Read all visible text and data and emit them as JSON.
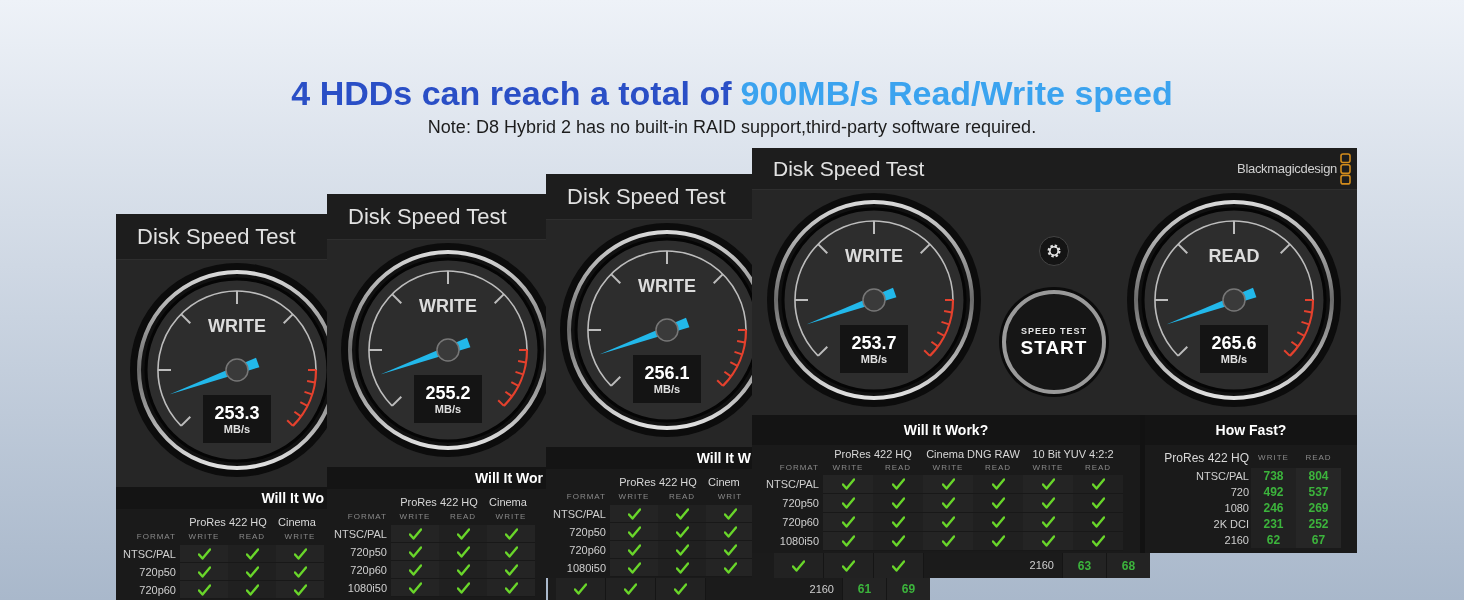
{
  "headline": {
    "lead": "4 HDDs can reach a total of",
    "highlight": "900MB/s Read/Write speed"
  },
  "note": "Note: D8 Hybrid 2 has no built-in RAID support,third-party software required.",
  "windows": [
    {
      "title": "Disk Speed Test",
      "gauges": [
        {
          "label": "WRITE",
          "value": "253.3",
          "unit": "MB/s"
        }
      ],
      "will_it_work": {
        "title": "Will It Wo",
        "format_label": "FORMAT",
        "groups": [
          {
            "name": "ProRes 422 HQ",
            "columns": [
              "WRITE",
              "READ"
            ]
          },
          {
            "name": "Cinema",
            "columns": [
              "WRITE"
            ]
          }
        ],
        "rows": [
          {
            "format": "NTSC/PAL",
            "checks": [
              true,
              true,
              true
            ]
          },
          {
            "format": "720p50",
            "checks": [
              true,
              true,
              true
            ]
          },
          {
            "format": "720p60",
            "checks": [
              true,
              true,
              true
            ]
          }
        ]
      }
    },
    {
      "title": "Disk Speed Test",
      "gauges": [
        {
          "label": "WRITE",
          "value": "255.2",
          "unit": "MB/s"
        }
      ],
      "will_it_work": {
        "title": "Will It Wor",
        "format_label": "FORMAT",
        "groups": [
          {
            "name": "ProRes 422 HQ",
            "columns": [
              "WRITE",
              "READ"
            ]
          },
          {
            "name": "Cinema",
            "columns": [
              "WRITE"
            ]
          }
        ],
        "rows": [
          {
            "format": "NTSC/PAL",
            "checks": [
              true,
              true,
              true
            ]
          },
          {
            "format": "720p50",
            "checks": [
              true,
              true,
              true
            ]
          },
          {
            "format": "720p60",
            "checks": [
              true,
              true,
              true
            ]
          },
          {
            "format": "1080i50",
            "checks": [
              true,
              true,
              true
            ]
          }
        ]
      }
    },
    {
      "title": "Disk Speed Test",
      "gauges": [
        {
          "label": "WRITE",
          "value": "256.1",
          "unit": "MB/s"
        }
      ],
      "will_it_work": {
        "title": "Will It W",
        "format_label": "FORMAT",
        "groups": [
          {
            "name": "ProRes 422 HQ",
            "columns": [
              "WRITE",
              "READ"
            ]
          },
          {
            "name": "Cinem",
            "columns": [
              "WRIT"
            ]
          }
        ],
        "rows": [
          {
            "format": "NTSC/PAL",
            "checks": [
              true,
              true,
              true
            ]
          },
          {
            "format": "720p50",
            "checks": [
              true,
              true,
              true
            ]
          },
          {
            "format": "720p60",
            "checks": [
              true,
              true,
              true
            ]
          },
          {
            "format": "1080i50",
            "checks": [
              true,
              true,
              true
            ]
          }
        ]
      }
    },
    {
      "title": "Disk Speed Test",
      "logo": "Blackmagicdesign",
      "gauges": [
        {
          "label": "WRITE",
          "value": "253.7",
          "unit": "MB/s"
        },
        {
          "label": "READ",
          "value": "265.6",
          "unit": "MB/s"
        }
      ],
      "start_button": {
        "top": "SPEED TEST",
        "main": "START"
      },
      "will_it_work": {
        "title": "Will It Work?",
        "format_label": "FORMAT",
        "groups": [
          {
            "name": "ProRes 422 HQ",
            "columns": [
              "WRITE",
              "READ"
            ]
          },
          {
            "name": "Cinema DNG RAW",
            "columns": [
              "WRITE",
              "READ"
            ]
          },
          {
            "name": "10 Bit YUV 4:2:2",
            "columns": [
              "WRITE",
              "READ"
            ]
          }
        ],
        "rows": [
          {
            "format": "NTSC/PAL",
            "checks": [
              true,
              true,
              true,
              true,
              true,
              true
            ]
          },
          {
            "format": "720p50",
            "checks": [
              true,
              true,
              true,
              true,
              true,
              true
            ]
          },
          {
            "format": "720p60",
            "checks": [
              true,
              true,
              true,
              true,
              true,
              true
            ]
          },
          {
            "format": "1080i50",
            "checks": [
              true,
              true,
              true,
              true,
              true,
              true
            ]
          }
        ]
      },
      "how_fast": {
        "title": "How Fast?",
        "group": "ProRes 422 HQ",
        "columns": [
          "WRITE",
          "READ"
        ],
        "rows": [
          {
            "format": "NTSC/PAL",
            "write": "738",
            "read": "804"
          },
          {
            "format": "720",
            "write": "492",
            "read": "537"
          },
          {
            "format": "1080",
            "write": "246",
            "read": "269"
          },
          {
            "format": "2K DCI",
            "write": "231",
            "read": "252"
          },
          {
            "format": "2160",
            "write": "62",
            "read": "67"
          }
        ]
      }
    }
  ],
  "fragments": [
    {
      "checks": [
        true,
        true,
        true
      ],
      "format": "2160",
      "write": "63",
      "read": "68"
    },
    {
      "checks": [
        true,
        true,
        true
      ],
      "format": "2160",
      "write": "61",
      "read": "69"
    }
  ]
}
